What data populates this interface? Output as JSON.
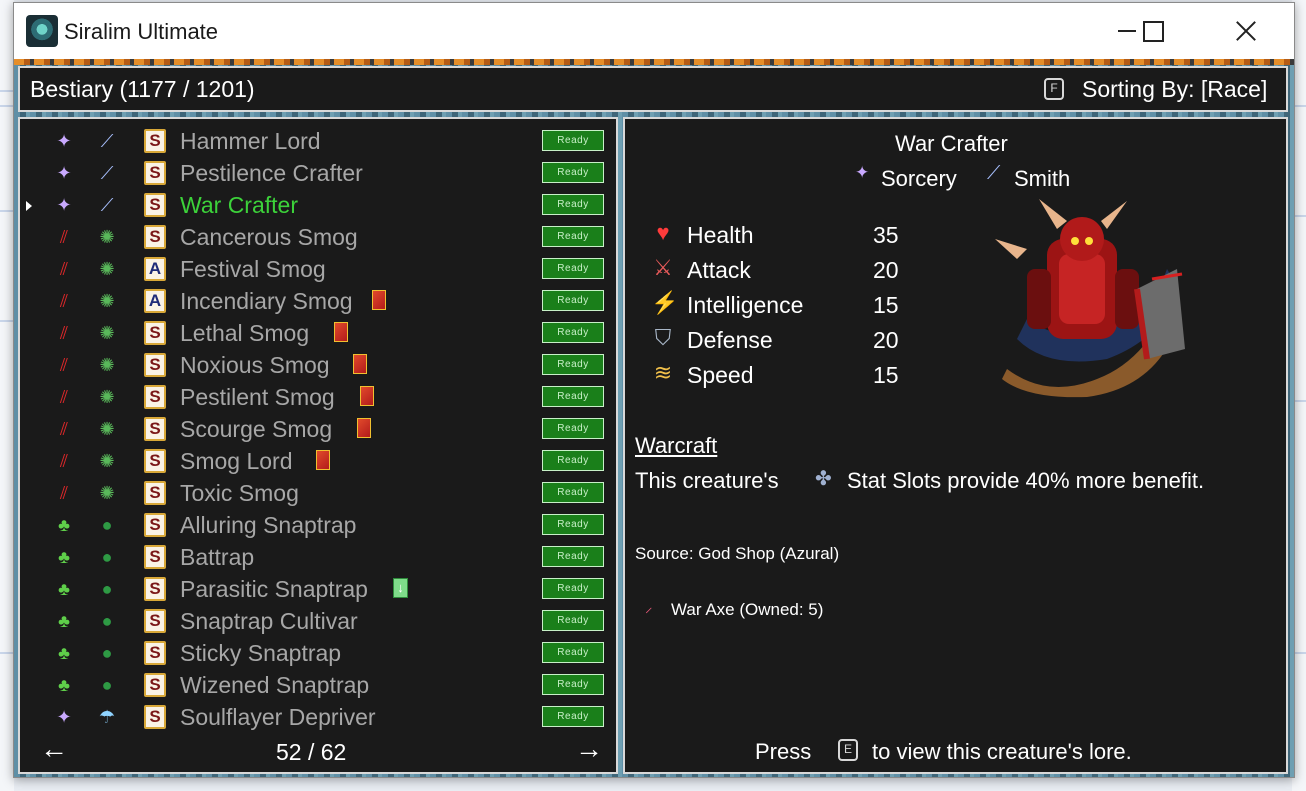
{
  "window": {
    "title": "Siralim Ultimate"
  },
  "header": {
    "title": "Bestiary (1177 / 1201)",
    "sort_key": "F",
    "sort_text": "Sorting By: [Race]"
  },
  "list": {
    "items": [
      {
        "name": "Hammer Lord",
        "race_icon": "sorcery-icon",
        "family_icon": "axe-icon",
        "class_badge": "S",
        "card": "",
        "status": "Ready"
      },
      {
        "name": "Pestilence Crafter",
        "race_icon": "sorcery-icon",
        "family_icon": "axe-icon",
        "class_badge": "S",
        "card": "",
        "status": "Ready"
      },
      {
        "name": "War Crafter",
        "race_icon": "sorcery-icon",
        "family_icon": "axe-icon",
        "class_badge": "S",
        "card": "",
        "status": "Ready"
      },
      {
        "name": "Cancerous Smog",
        "race_icon": "claw-icon",
        "family_icon": "smog-icon",
        "class_badge": "S",
        "card": "",
        "status": "Ready"
      },
      {
        "name": "Festival Smog",
        "race_icon": "claw-icon",
        "family_icon": "smog-icon",
        "class_badge": "A",
        "card": "",
        "status": "Ready"
      },
      {
        "name": "Incendiary Smog",
        "race_icon": "claw-icon",
        "family_icon": "smog-icon",
        "class_badge": "A",
        "card": "red",
        "status": "Ready"
      },
      {
        "name": "Lethal Smog",
        "race_icon": "claw-icon",
        "family_icon": "smog-icon",
        "class_badge": "S",
        "card": "red",
        "status": "Ready"
      },
      {
        "name": "Noxious Smog",
        "race_icon": "claw-icon",
        "family_icon": "smog-icon",
        "class_badge": "S",
        "card": "red",
        "status": "Ready"
      },
      {
        "name": "Pestilent Smog",
        "race_icon": "claw-icon",
        "family_icon": "smog-icon",
        "class_badge": "S",
        "card": "red",
        "status": "Ready"
      },
      {
        "name": "Scourge Smog",
        "race_icon": "claw-icon",
        "family_icon": "smog-icon",
        "class_badge": "S",
        "card": "red",
        "status": "Ready"
      },
      {
        "name": "Smog Lord",
        "race_icon": "claw-icon",
        "family_icon": "smog-icon",
        "class_badge": "S",
        "card": "red",
        "status": "Ready"
      },
      {
        "name": "Toxic Smog",
        "race_icon": "claw-icon",
        "family_icon": "smog-icon",
        "class_badge": "S",
        "card": "",
        "status": "Ready"
      },
      {
        "name": "Alluring Snaptrap",
        "race_icon": "leaf-icon",
        "family_icon": "snaptrap-icon",
        "class_badge": "S",
        "card": "",
        "status": "Ready"
      },
      {
        "name": "Battrap",
        "race_icon": "leaf-icon",
        "family_icon": "snaptrap-icon",
        "class_badge": "S",
        "card": "",
        "status": "Ready"
      },
      {
        "name": "Parasitic Snaptrap",
        "race_icon": "leaf-icon",
        "family_icon": "snaptrap-icon",
        "class_badge": "S",
        "card": "green",
        "status": "Ready"
      },
      {
        "name": "Snaptrap Cultivar",
        "race_icon": "leaf-icon",
        "family_icon": "snaptrap-icon",
        "class_badge": "S",
        "card": "",
        "status": "Ready"
      },
      {
        "name": "Sticky Snaptrap",
        "race_icon": "leaf-icon",
        "family_icon": "snaptrap-icon",
        "class_badge": "S",
        "card": "",
        "status": "Ready"
      },
      {
        "name": "Wizened Snaptrap",
        "race_icon": "leaf-icon",
        "family_icon": "snaptrap-icon",
        "class_badge": "S",
        "card": "",
        "status": "Ready"
      },
      {
        "name": "Soulflayer Depriver",
        "race_icon": "sorcery-icon",
        "family_icon": "jellyfish-icon",
        "class_badge": "S",
        "card": "",
        "status": "Ready"
      }
    ],
    "selected_index": 2,
    "page": "52 / 62"
  },
  "detail": {
    "name": "War Crafter",
    "class": "Sorcery",
    "family": "Smith",
    "stats": [
      {
        "label": "Health",
        "value": "35",
        "icon": "heart-icon"
      },
      {
        "label": "Attack",
        "value": "20",
        "icon": "sword-icon"
      },
      {
        "label": "Intelligence",
        "value": "15",
        "icon": "lightning-icon"
      },
      {
        "label": "Defense",
        "value": "20",
        "icon": "shield-icon"
      },
      {
        "label": "Speed",
        "value": "15",
        "icon": "wing-icon"
      }
    ],
    "trait_name": "Warcraft",
    "trait_before": "This creature's",
    "trait_after": "Stat Slots provide 40% more benefit.",
    "source": "Source: God Shop (Azural)",
    "material": "War Axe (Owned: 5)",
    "footer_press": "Press",
    "footer_key": "E",
    "footer_text": "to view this creature's lore."
  },
  "colors": {
    "selected": "#3cd23a",
    "ready_bg": "#1a7f1a",
    "panel_bg": "#1a1a1a"
  }
}
